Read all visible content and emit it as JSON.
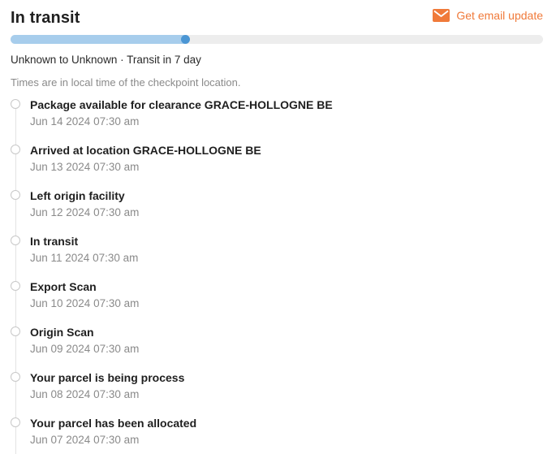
{
  "status": {
    "title": "In transit"
  },
  "email": {
    "label": "Get email update",
    "icon": "mail-icon",
    "color": "#f07a3a"
  },
  "progress": {
    "fraction": 0.34,
    "fill_color": "#a7cdec",
    "dot_color": "#4b96d4",
    "track_color": "#ededed"
  },
  "route": {
    "text": "Unknown to Unknown · Transit in 7 day"
  },
  "timezone_note": "Times are in local time of the checkpoint location.",
  "events": [
    {
      "title": "Package available for clearance GRACE-HOLLOGNE BE",
      "time": "Jun 14 2024 07:30 am"
    },
    {
      "title": "Arrived at location GRACE-HOLLOGNE BE",
      "time": "Jun 13 2024 07:30 am"
    },
    {
      "title": "Left origin facility",
      "time": "Jun 12 2024 07:30 am"
    },
    {
      "title": "In transit",
      "time": "Jun 11 2024 07:30 am"
    },
    {
      "title": "Export Scan",
      "time": "Jun 10 2024 07:30 am"
    },
    {
      "title": "Origin Scan",
      "time": "Jun 09 2024 07:30 am"
    },
    {
      "title": "Your parcel is being process",
      "time": "Jun 08 2024 07:30 am"
    },
    {
      "title": "Your parcel has been allocated",
      "time": "Jun 07 2024 07:30 am"
    }
  ]
}
